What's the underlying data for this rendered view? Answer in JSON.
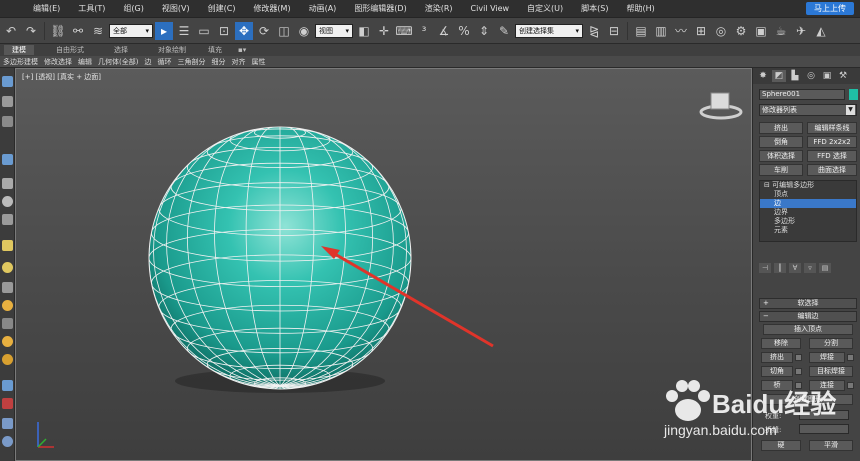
{
  "menu": {
    "items": [
      "编辑(E)",
      "工具(T)",
      "组(G)",
      "视图(V)",
      "创建(C)",
      "修改器(M)",
      "动画(A)",
      "图形编辑器(D)",
      "渲染(R)",
      "Civil View",
      "自定义(U)",
      "脚本(S)",
      "帮助(H)"
    ],
    "login_label": "马上上传"
  },
  "toolbar": {
    "filter_select": "全部",
    "view_select": "视图",
    "selection_set": "创建选择集"
  },
  "ribbon": {
    "tabs": [
      "建模",
      "自由形式",
      "选择",
      "对象绘制",
      "填充"
    ],
    "active_tab": "建模",
    "sub_items": [
      "多边形建模",
      "修改选择",
      "编辑",
      "几何体(全部)",
      "边",
      "循环",
      "三角剖分",
      "细分",
      "对齐",
      "属性"
    ]
  },
  "viewport": {
    "label": "[+] [透视] [真实 + 边面]",
    "sphere_color": "#2ebfae",
    "arrow_color": "#e0342a"
  },
  "command_panel": {
    "object_name": "Sphere001",
    "modifier_list": "修改器列表",
    "quick_buttons": [
      [
        "挤出",
        "编辑样条线"
      ],
      [
        "倒角",
        "FFD 2x2x2"
      ],
      [
        "体积选择",
        "FFD 选择"
      ],
      [
        "车削",
        "曲面选择"
      ]
    ],
    "stack": {
      "root": "可编辑多边形",
      "levels": [
        "顶点",
        "边",
        "边界",
        "多边形",
        "元素"
      ],
      "selected": "边"
    },
    "rollouts": {
      "soft_select": "软选择",
      "edit_edges": "编辑边"
    },
    "edit_edges": {
      "insert_vertex": "插入顶点",
      "remove": "移除",
      "split": "分割",
      "extrude": "挤出",
      "weld": "焊接",
      "chamfer": "切角",
      "target_weld": "目标焊接",
      "bridge": "桥",
      "connect": "连接",
      "create_shape": "创建图形",
      "weight": "权重:",
      "crease": "折缝:",
      "hard": "硬",
      "smooth": "平滑"
    }
  },
  "watermark": {
    "brand": "Baidu经验",
    "url": "jingyan.baidu.com"
  }
}
